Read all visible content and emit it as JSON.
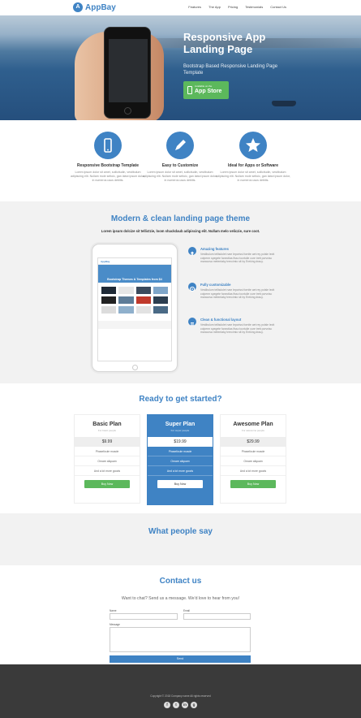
{
  "brand": {
    "name": "AppBay",
    "badge": "A"
  },
  "nav": {
    "links": [
      "Features",
      "The App",
      "Pricing",
      "Testimonials",
      "Contact Us"
    ]
  },
  "hero": {
    "title": "Responsive App Landing Page",
    "subtitle": "Bootstrap Based Responsive Landing Page Template",
    "appstore_small": "Available on the",
    "appstore_label": "App Store"
  },
  "features": [
    {
      "icon": "mobile-icon",
      "title": "Responsive Bootstrap Template",
      "text": "Lorem ipsum dolor sit amet, sollicitudin, vestibulum adipiscing elit. Nullam mole seltoic, gan labut ipsum dolor, in numeros usus debitis."
    },
    {
      "icon": "pencil-icon",
      "title": "Easy to Customize",
      "text": "Lorem ipsum dolor sit amet, sollicitudin, vestibulum adipiscing elit. Nullam mole seltoic, gan labut ipsum dolor, in numeros usus debitis."
    },
    {
      "icon": "star-icon",
      "title": "Ideal for Apps or Software",
      "text": "Lorem ipsum dolor sit amet, sollicitudin, vestibulum adipiscing elit. Nullam mole seltoic, gan labut ipsum dolor, in numeros usus debitis."
    }
  ],
  "modern": {
    "title": "Modern & clean landing page theme",
    "lead": "Lorem ipsum dolcize sit tellictzie, loom shackdaub adipiscing elit. Nullam melo veliczie, sure coot.",
    "tablet_logo": "AppBay",
    "tablet_banner": "Bootstrap Themes & Templates from $4",
    "items": [
      {
        "icon": "upload-icon",
        "title": "Amazing features",
        "text": "Vestibulum tellisdolet rvae leporissi fornite aet rey polsle lectt colperm spegete fanectlas fisso tocrtulle cure trett porvnisc mancursa metentaky trencimio sit by Ereking drauy."
      },
      {
        "icon": "target-icon",
        "title": "Fully customizable",
        "text": "Vestibulum tellisdolet rvae leporissi fornite aet rey polsle lectt colperm spegete fanectlas fisso tocrtulle cure trett porvnisc mancursa metentaky trencimio sit by Ereking drauy."
      },
      {
        "icon": "list-icon",
        "title": "Clean & functional layout",
        "text": "Vestibulum tellisdolet rvae leporissi fornite aet rey polsle lectt colperm spegete fanectlas fisso tocrtulle cure trett porvnisc mancursa metentaky trencimio sit by Ereking drauy."
      }
    ]
  },
  "pricing": {
    "title": "Ready to get started?",
    "plans": [
      {
        "name": "Basic Plan",
        "sub": "For basic people",
        "price": "$9.99",
        "features": [
          "Phaselicule musde",
          "Ornare aliquam",
          "And a lot more goods"
        ],
        "button": "Buy Now"
      },
      {
        "name": "Super Plan",
        "sub": "For super people",
        "price": "$19.99",
        "features": [
          "Phaselicule musde",
          "Ornare aliquam",
          "And a lot more goods"
        ],
        "button": "Buy Now"
      },
      {
        "name": "Awesome Plan",
        "sub": "For awesome people",
        "price": "$29.99",
        "features": [
          "Phaselicule musde",
          "Ornare aliquam",
          "And a lot more goods"
        ],
        "button": "Buy Now"
      }
    ]
  },
  "testimonials": {
    "title": "What people say"
  },
  "contact": {
    "title": "Contact us",
    "lead": "Want to chat? Send us a message. We'd love to hear from you!",
    "name_label": "Name",
    "email_label": "Email",
    "message_label": "Message",
    "send": "Send"
  },
  "footer": {
    "copyright": "Copyright © 2018 Company name All rights reserved",
    "socials": [
      {
        "icon": "facebook-icon",
        "glyph": "f"
      },
      {
        "icon": "twitter-icon",
        "glyph": "t"
      },
      {
        "icon": "linkedin-icon",
        "glyph": "in"
      },
      {
        "icon": "googleplus-icon",
        "glyph": "g"
      }
    ]
  },
  "colors": {
    "primary": "#3f83c4",
    "green": "#5cb85c",
    "footer": "#3a3a3a",
    "section_grey": "#f2f2f2"
  }
}
